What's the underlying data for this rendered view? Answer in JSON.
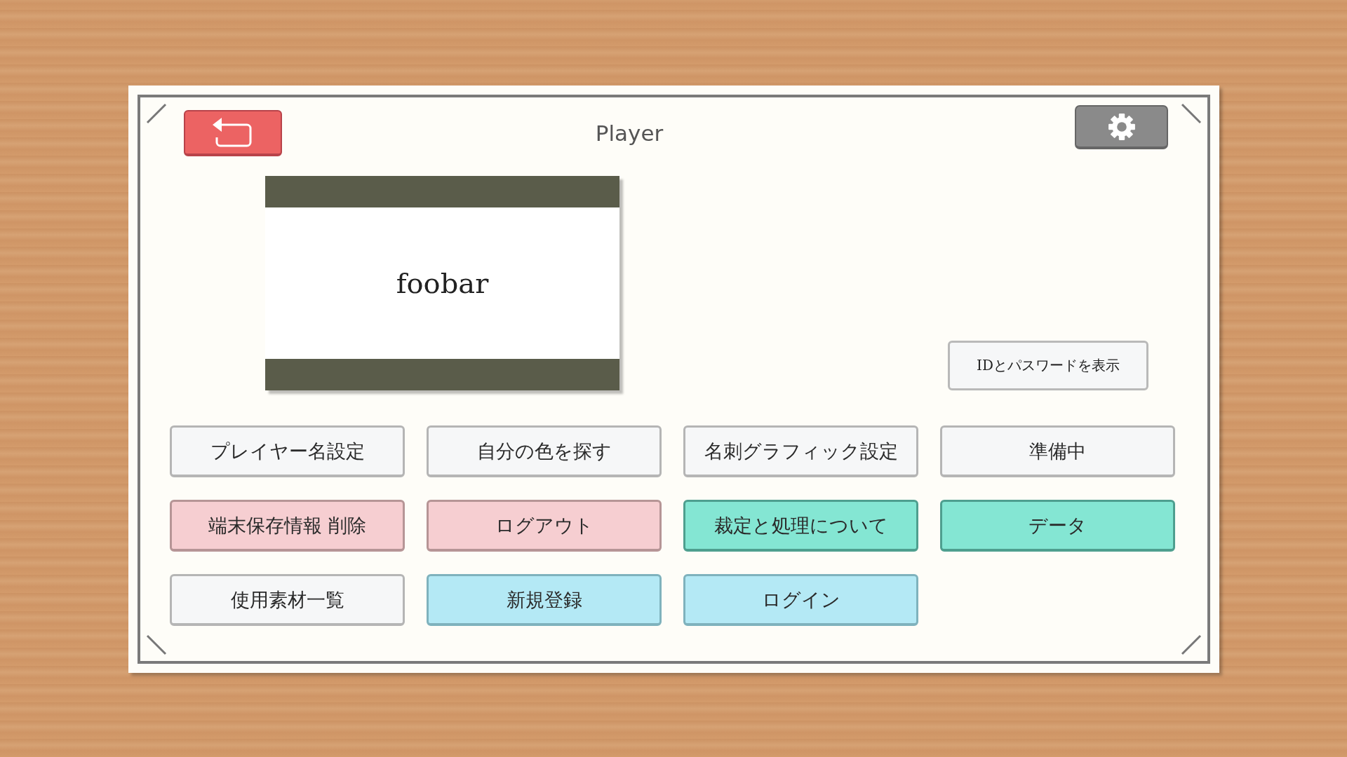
{
  "header": {
    "title": "Player"
  },
  "card": {
    "name": "foobar"
  },
  "show_credentials_button": {
    "label": "IDとパスワードを表示"
  },
  "menu_buttons": [
    {
      "label": "プレイヤー名設定",
      "kind": "neutral"
    },
    {
      "label": "自分の色を探す",
      "kind": "neutral"
    },
    {
      "label": "名刺グラフィック設定",
      "kind": "neutral"
    },
    {
      "label": "準備中",
      "kind": "neutral"
    },
    {
      "label": "端末保存情報 削除",
      "kind": "danger"
    },
    {
      "label": "ログアウト",
      "kind": "danger"
    },
    {
      "label": "裁定と処理について",
      "kind": "info"
    },
    {
      "label": "データ",
      "kind": "info"
    },
    {
      "label": "使用素材一覧",
      "kind": "neutral"
    },
    {
      "label": "新規登録",
      "kind": "account"
    },
    {
      "label": "ログイン",
      "kind": "account"
    }
  ]
}
